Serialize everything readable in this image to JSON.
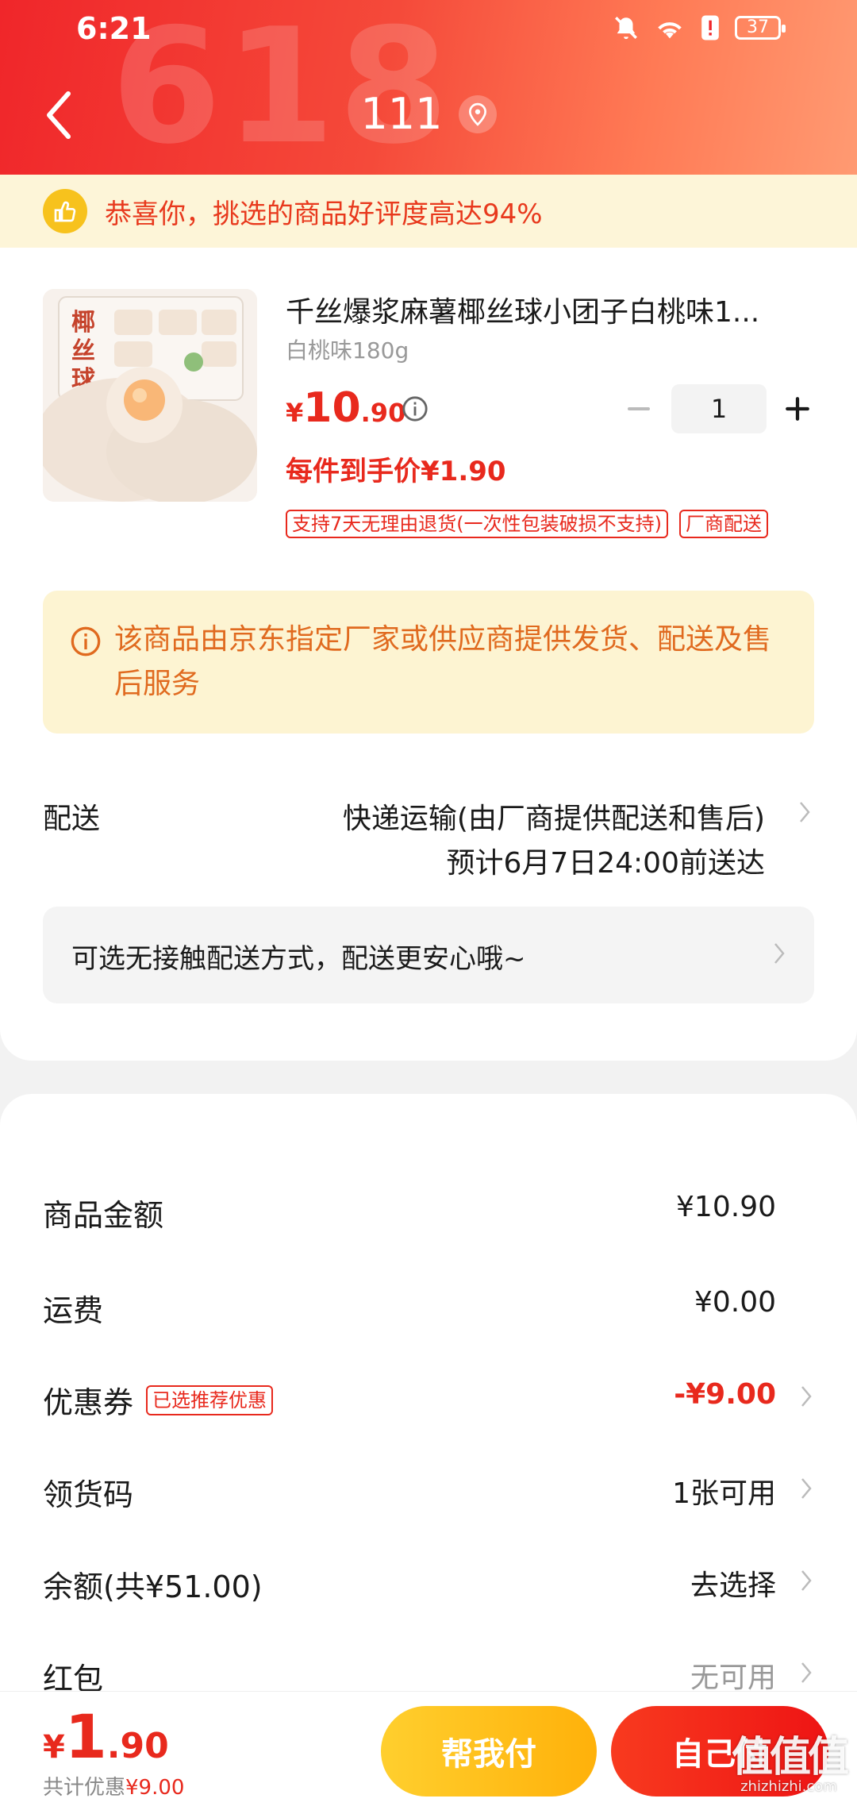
{
  "status_bar": {
    "time": "6:21",
    "battery": "37"
  },
  "header": {
    "background_text": "618",
    "title": "111"
  },
  "banner": {
    "text": "恭喜你，挑选的商品好评度高达94%"
  },
  "product": {
    "title": "千丝爆浆麻薯椰丝球小团子白桃味1...",
    "spec": "白桃味180g",
    "price_symbol": "¥",
    "price_int": "10",
    "price_dec": ".90",
    "unit_price": "每件到手价¥1.90",
    "quantity": "1",
    "image_text": "椰丝球",
    "tags": [
      "支持7天无理由退货(一次性包装破损不支持)",
      "厂商配送"
    ]
  },
  "notice": {
    "text": "该商品由京东指定厂家或供应商提供发货、配送及售后服务"
  },
  "delivery": {
    "label": "配送",
    "method": "快递运输(由厂商提供配送和售后)",
    "eta": "预计6月7日24:00前送达",
    "contactless": "可选无接触配送方式，配送更安心哦~"
  },
  "summary": {
    "rows": [
      {
        "label": "商品金额",
        "value": "¥10.90"
      },
      {
        "label": "运费",
        "value": "¥0.00"
      },
      {
        "label": "优惠券",
        "tag": "已选推荐优惠",
        "value": "-¥9.00"
      },
      {
        "label": "领货码",
        "value": "1张可用"
      },
      {
        "label": "余额(共¥51.00)",
        "value": "去选择"
      },
      {
        "label": "红包",
        "value": "无可用"
      }
    ]
  },
  "bottom_bar": {
    "total_symbol": "¥",
    "total_int": "1",
    "total_dec": ".90",
    "saving_label": "共计优惠",
    "saving_value": "¥9.00",
    "help_pay": "帮我付",
    "self_pay": "自己付",
    "watermark_logo": "值值值",
    "watermark_url": "zhizhizhi.com"
  },
  "colors": {
    "accent_red": "#e8291d",
    "header_red": "#f0262a",
    "notice_orange": "#e06a1f",
    "help_btn_yellow": "#ffb10a"
  },
  "icons": [
    "bell-off-icon",
    "wifi-icon",
    "alert-icon",
    "battery-icon",
    "back-chevron-icon",
    "location-icon",
    "thumbs-up-icon",
    "info-icon",
    "minus-icon",
    "plus-icon",
    "chevron-right-icon"
  ]
}
